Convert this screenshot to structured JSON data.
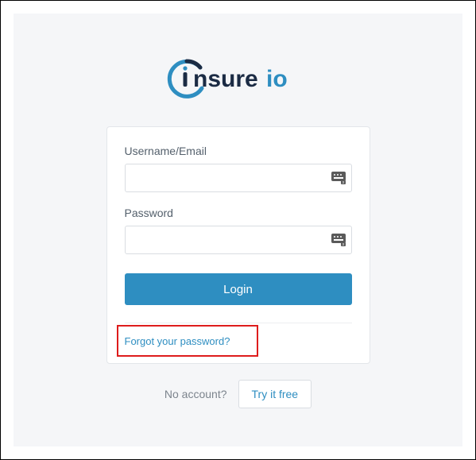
{
  "brand": {
    "name": "insureio",
    "primary_color": "#2e8ec1",
    "text_dark": "#1b2b44"
  },
  "form": {
    "username_label": "Username/Email",
    "username_value": "",
    "password_label": "Password",
    "password_value": "",
    "login_button": "Login",
    "forgot_link": "Forgot your password?"
  },
  "footer": {
    "no_account": "No account?",
    "try_button": "Try it free"
  },
  "annotation": {
    "highlight_target": "forgot-password-link",
    "highlight_color": "#de1c1c"
  }
}
